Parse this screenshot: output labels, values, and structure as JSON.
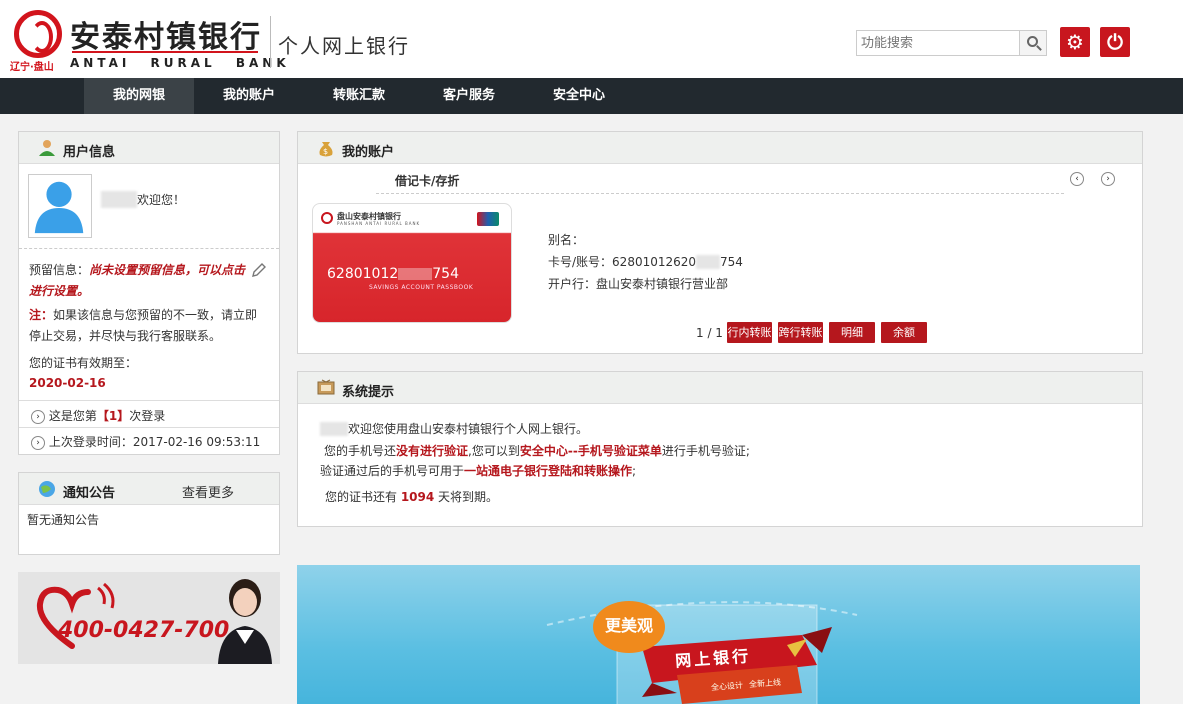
{
  "header": {
    "logo_sub": "辽宁·盘山",
    "bank_name_cn": "安泰村镇银行",
    "bank_name_en": "ANTAI RURAL BANK",
    "subtitle": "个人网上银行",
    "search_placeholder": "功能搜索"
  },
  "nav": {
    "items": [
      "我的网银",
      "我的账户",
      "转账汇款",
      "客户服务",
      "安全中心"
    ],
    "active_index": 0
  },
  "user_info": {
    "title": "用户信息",
    "welcome": "欢迎您！",
    "reserved_label": "预留信息：",
    "reserved_msg": "尚未设置预留信息，可以点击进行设置。",
    "note_label": "注：",
    "note_text": "如果该信息与您预留的不一致，请立即停止交易，并尽快与我行客服联系。",
    "cert_label": "您的证书有效期至：",
    "cert_date": "2020-02-16",
    "login_count_prefix": "这是您第",
    "login_count": "【1】",
    "login_count_suffix": "次登录",
    "last_login": "上次登录时间：2017-02-16 09:53:11"
  },
  "notice": {
    "title": "通知公告",
    "more": "查看更多",
    "empty": "暂无通知公告"
  },
  "hotline": {
    "phone": "400-0427-700"
  },
  "accounts": {
    "title": "我的账户",
    "tab": "借记卡/存折",
    "card_bank": "盘山安泰村镇银行",
    "card_bank_en": "PANSHAN ANTAI RURAL BANK",
    "card_number_prefix": "62801012",
    "card_number_suffix": "754",
    "card_passbook": "SAVINGS ACCOUNT PASSBOOK",
    "alias_label": "别名：",
    "account_label": "卡号/账号：",
    "account_prefix": "62801012620",
    "account_suffix": "754",
    "branch_label": "开户行：",
    "branch": "盘山安泰村镇银行营业部",
    "pager": "1 / 1",
    "actions": [
      "行内转账",
      "跨行转账",
      "明细",
      "余额"
    ]
  },
  "system": {
    "title": "系统提示",
    "line1": "欢迎您使用盘山安泰村镇银行个人网上银行。",
    "line2_a": "您的手机号还",
    "line2_b": "没有进行验证",
    "line2_c": ",您可以到",
    "line2_d": "安全中心--手机号验证菜单",
    "line2_e": "进行手机号验证;",
    "line3_a": "验证通过后的手机号可用于",
    "line3_b": "一站通电子银行登陆和转账操作",
    "line3_c": ";",
    "line4_a": "您的证书还有 ",
    "line4_b": "1094",
    "line4_c": " 天将到期。"
  },
  "banner": {
    "tag": "更美观",
    "ribbon": "网上银行",
    "sub1": "全心设计",
    "sub2": "全新上线"
  },
  "colors": {
    "brand_red": "#c8161e",
    "nav_bg": "#22292f"
  }
}
